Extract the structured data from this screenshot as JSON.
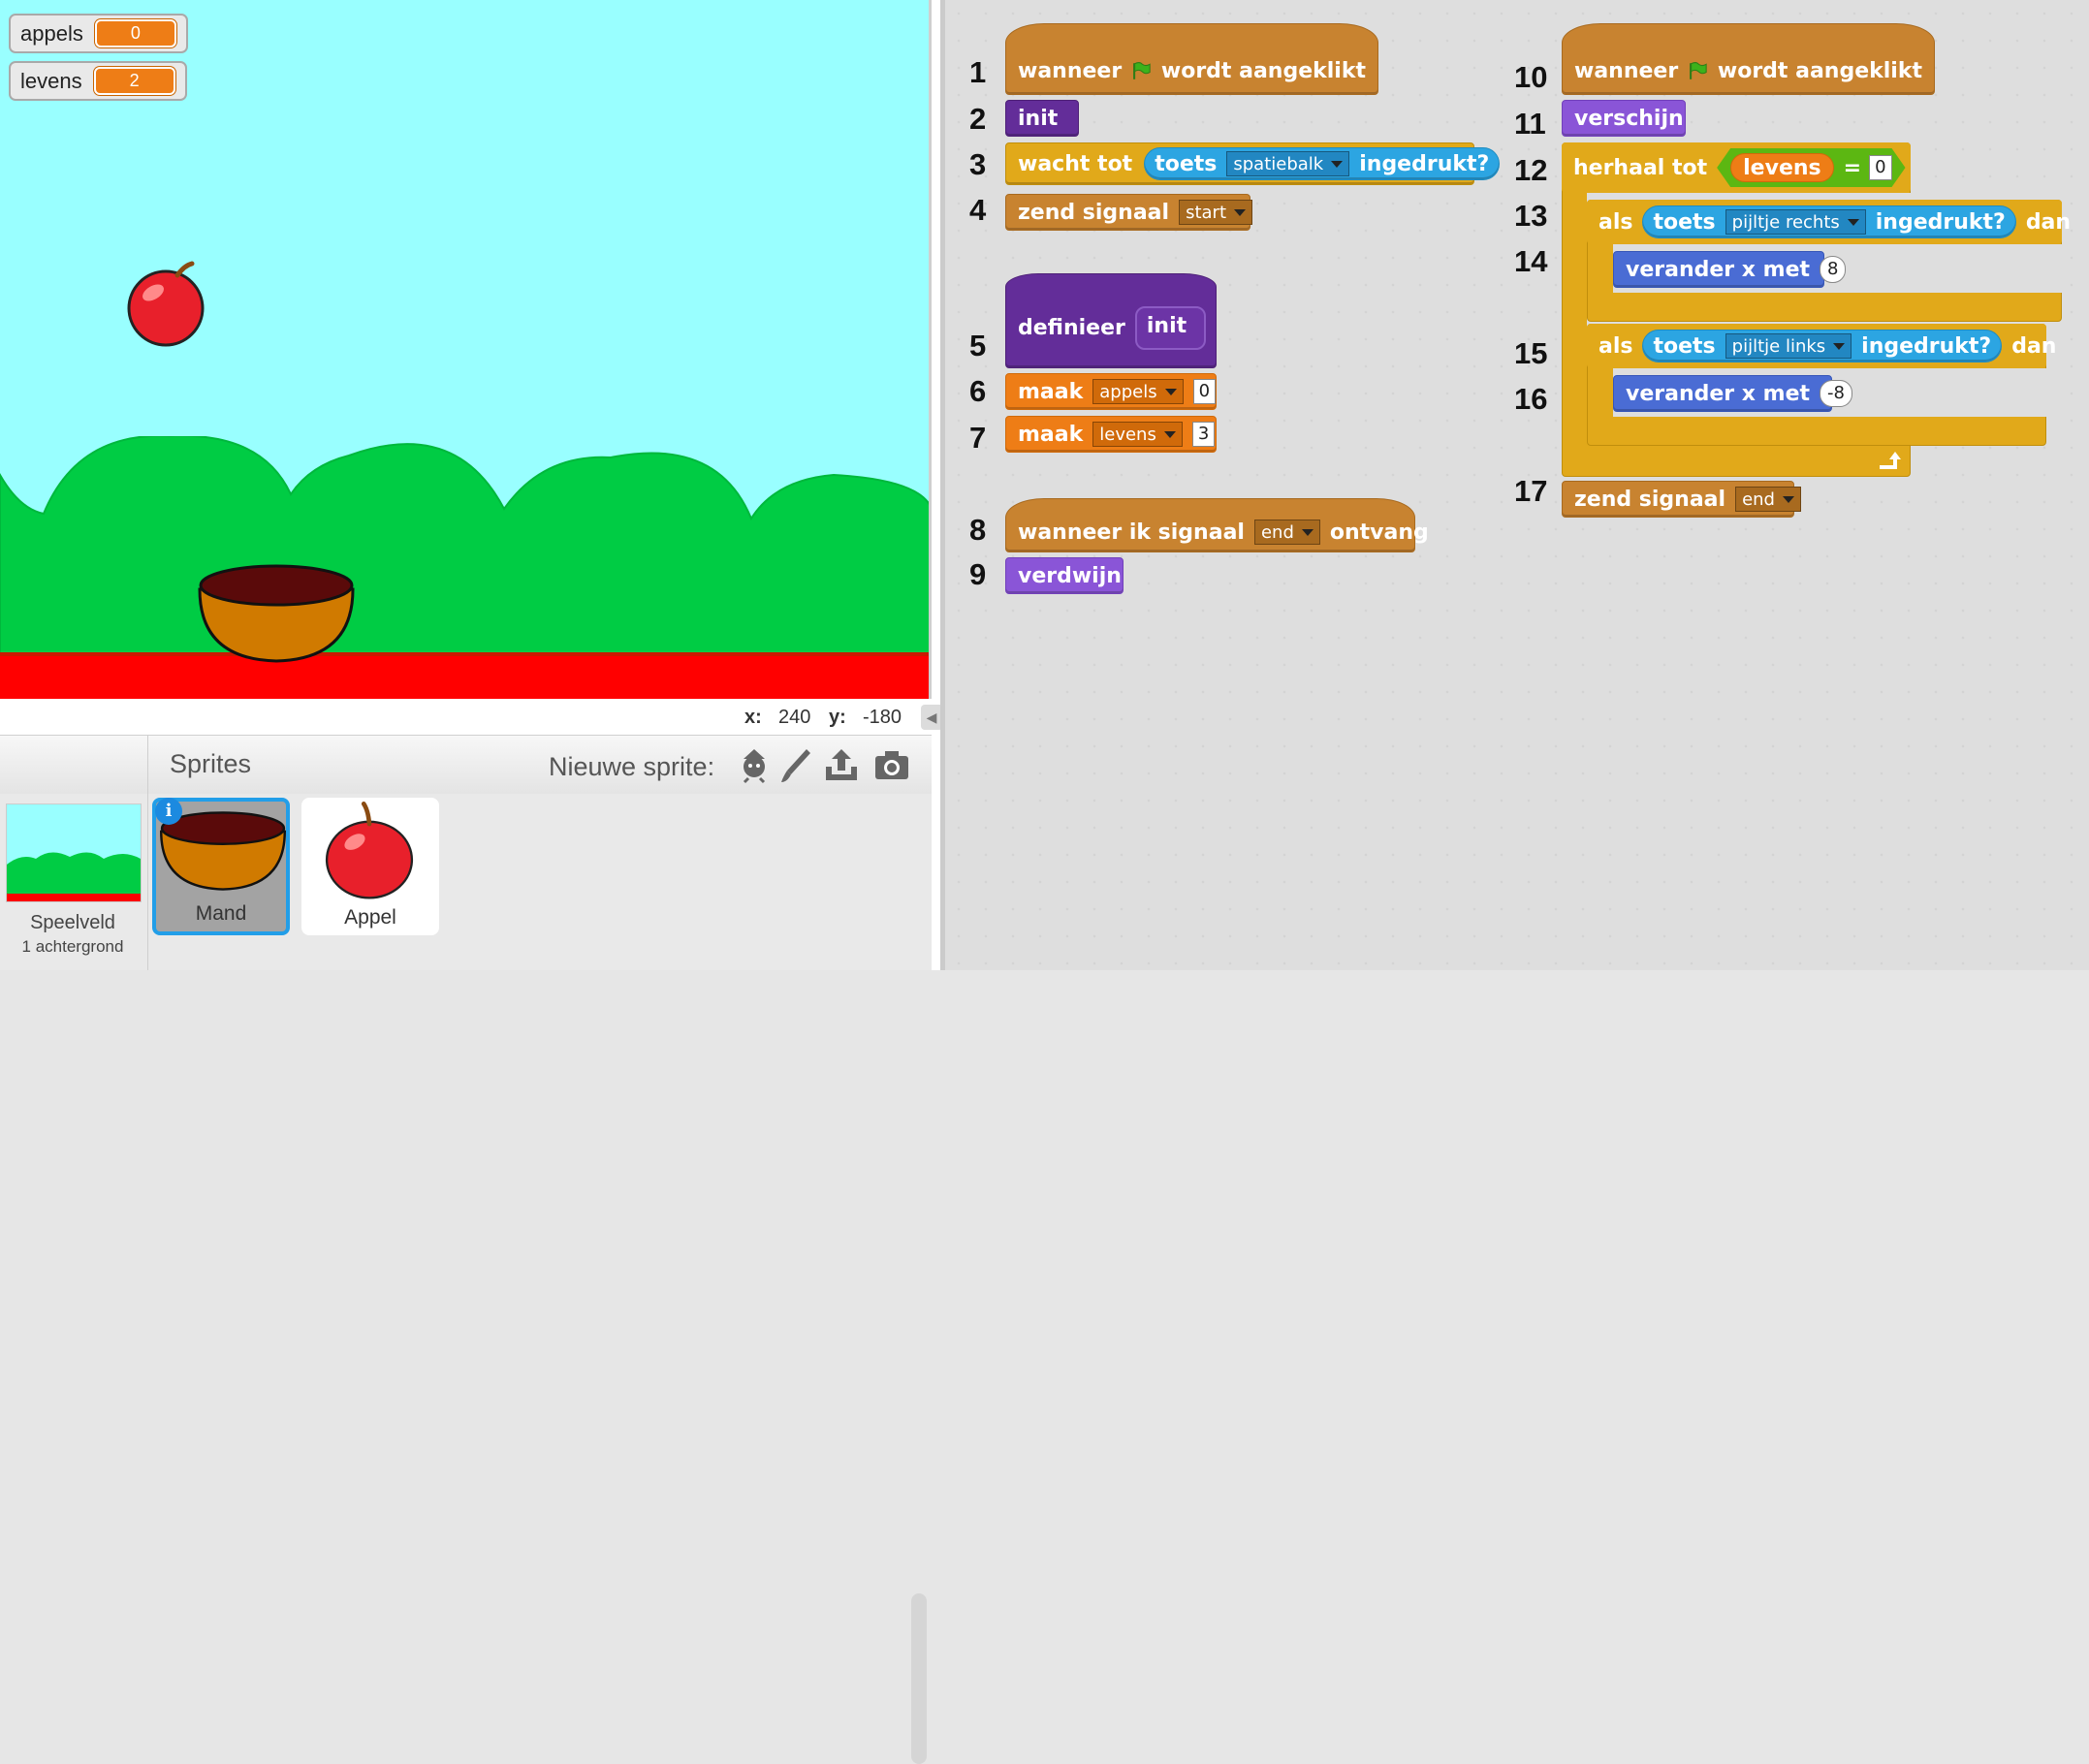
{
  "monitors": [
    {
      "label": "appels",
      "value": "0"
    },
    {
      "label": "levens",
      "value": "2"
    }
  ],
  "coords": {
    "x_label": "x:",
    "x_value": "240",
    "y_label": "y:",
    "y_value": "-180"
  },
  "sprite_panel": {
    "title": "Sprites",
    "new_sprite_label": "Nieuwe sprite:",
    "stage_name": "Speelveld",
    "stage_sub": "1 achtergrond",
    "info_badge": "i",
    "sprites": [
      {
        "name": "Mand",
        "selected": true
      },
      {
        "name": "Appel",
        "selected": false
      }
    ]
  },
  "line_numbers": [
    "1",
    "2",
    "3",
    "4",
    "5",
    "6",
    "7",
    "8",
    "9",
    "10",
    "11",
    "12",
    "13",
    "14",
    "15",
    "16",
    "17"
  ],
  "script1": {
    "hat_when": "wanneer",
    "hat_clicked": "wordt aangeklikt",
    "init": "init",
    "wait_until": "wacht tot",
    "key": "toets",
    "key_space": "spatiebalk",
    "pressed": "ingedrukt?",
    "broadcast": "zend signaal",
    "broadcast_start": "start"
  },
  "script2": {
    "define": "definieer",
    "define_name": "init",
    "set": "maak",
    "var1": "appels",
    "val1": "0",
    "var2": "levens",
    "val2": "3"
  },
  "script3": {
    "when_receive": "wanneer ik signaal",
    "signal": "end",
    "receive": "ontvang",
    "hide": "verdwijn"
  },
  "script4": {
    "hat_when": "wanneer",
    "hat_clicked": "wordt aangeklikt",
    "show": "verschijn",
    "repeat_until": "herhaal tot",
    "rep_var": "levens",
    "eq": "=",
    "rep_val": "0",
    "if": "als",
    "then": "dan",
    "key": "toets",
    "key_right": "pijltje rechts",
    "key_left": "pijltje links",
    "pressed": "ingedrukt?",
    "change_x": "verander x met",
    "right_val": "8",
    "left_val": "-8",
    "broadcast": "zend signaal",
    "broadcast_end": "end"
  },
  "colors": {
    "sky": "#99ffff",
    "grass": "#00cc44",
    "floor": "#ff0000",
    "events": "#c88330",
    "more_blocks": "#632d99",
    "control": "#e1a91a",
    "sensing": "#2ca5e2",
    "looks": "#8a55d7",
    "data": "#ee7d16",
    "motion": "#4a6cd4",
    "operators": "#5cb712"
  }
}
